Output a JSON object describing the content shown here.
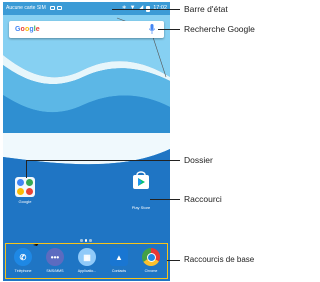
{
  "status_bar": {
    "carrier": "Aucune carte SIM",
    "time": "17:02"
  },
  "search": {
    "logo": "Google",
    "mic_icon": "microphone-icon"
  },
  "home": {
    "folder": {
      "label": "Google",
      "icon": "folder-icon"
    },
    "shortcut": {
      "label": "Play Store",
      "icon": "play-store-icon"
    },
    "page_indicator": {
      "pages": 3,
      "active": 1
    }
  },
  "dock": {
    "items": [
      {
        "label": "Téléphone",
        "icon": "phone-icon",
        "color": "#1e88e5"
      },
      {
        "label": "SMS/MMS",
        "icon": "messaging-icon",
        "color": "#5c6bc0"
      },
      {
        "label": "Applicatio...",
        "icon": "app-drawer-icon",
        "color": "#90caf9"
      },
      {
        "label": "Contacts",
        "icon": "contacts-icon",
        "color": "#1976d2"
      },
      {
        "label": "Chrome",
        "icon": "chrome-icon",
        "color": "#e53935"
      }
    ]
  },
  "callouts": {
    "status_bar": "Barre d'état",
    "search": "Recherche Google",
    "folder": "Dossier",
    "shortcut": "Raccourci",
    "dock": "Raccourcis de base"
  },
  "colors": {
    "sky": "#2f8fd1",
    "highlight": "#f6c41b",
    "google_blue": "#4285f4",
    "google_red": "#ea4335",
    "google_yellow": "#fbbc05",
    "google_green": "#34a853"
  }
}
